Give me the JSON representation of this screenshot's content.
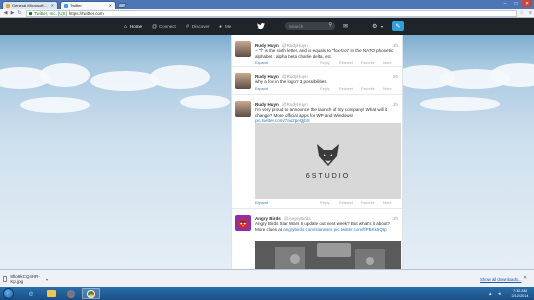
{
  "browser": {
    "tabs": [
      {
        "title": "General Microsoft News",
        "active": false
      },
      {
        "title": "Twitter",
        "active": true
      }
    ],
    "ev_label": "Twitter, Inc. [US]",
    "url": "https://twitter.com"
  },
  "twitter_nav": {
    "home": "Home",
    "connect": "Connect",
    "discover": "Discover",
    "me": "Me",
    "search_placeholder": "Search"
  },
  "tweets": [
    {
      "name": "Rudy Huyn",
      "handle": "@RudyHuyn",
      "time": "2h",
      "text": "~ \"f\" is the sixth letter, and is equals to \"fox-trot\" in the NATO phonetic alphabet : alpha beta charlie delta, etc.",
      "actions": {
        "expand": "Expand",
        "reply": "Reply",
        "retweet": "Retweet",
        "favorite": "Favorite",
        "more": "More"
      }
    },
    {
      "name": "Rudy Huyn",
      "handle": "@RudyHuyn",
      "time": "2h",
      "text": "why a fox in the logo? 3 possibilities",
      "actions": {
        "expand": "Expand",
        "reply": "Reply",
        "retweet": "Retweet",
        "favorite": "Favorite",
        "more": "More"
      }
    },
    {
      "name": "Rudy Huyn",
      "handle": "@RudyHuyn",
      "time": "2h",
      "text": "I'm very proud to announce the launch of my company! What will it change? More official apps for WP and Windows!",
      "link": "pic.twitter.com/7au2peQjbS",
      "media_text": "6STUDIO",
      "actions": {
        "expand": "Expand",
        "reply": "Reply",
        "retweet": "Retweet",
        "favorite": "Favorite",
        "more": "More"
      }
    },
    {
      "name": "Angry Birds",
      "handle": "@AngryBirds",
      "time": "2h",
      "text": "Angry Birds Star Wars II update out next week? But what's it about? More clues at",
      "link_inline": "angrybirds.com/starwars",
      "link": "pic.twitter.com/lfPBKk5Qtp"
    }
  ],
  "downloads": {
    "item": "8fto9kCQ4HR-Kp.jpg",
    "show_all": "Show all downloads..."
  },
  "taskbar": {
    "time": "7:32 AM",
    "date": "2/12/2014"
  }
}
